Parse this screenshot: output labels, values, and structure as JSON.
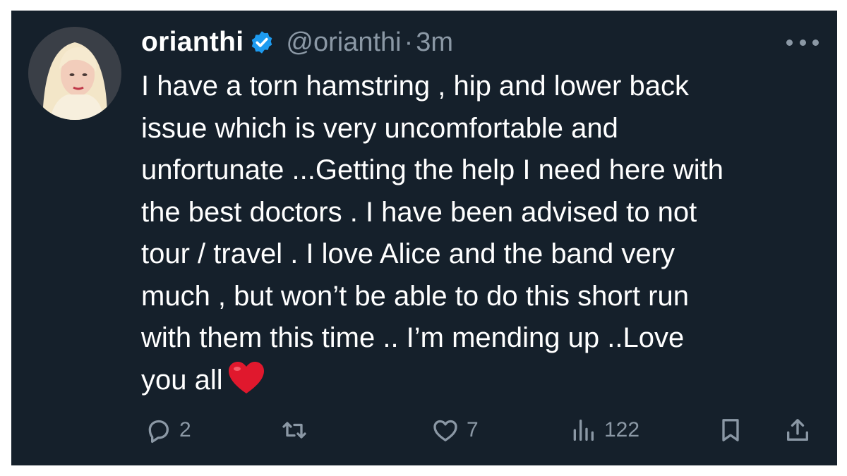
{
  "tweet": {
    "author": {
      "name": "orianthi",
      "handle": "@orianthi",
      "verified": true
    },
    "separator": "·",
    "time": "3m",
    "text_lines": [
      "I have a torn hamstring , hip and lower back",
      "issue which is very uncomfortable and",
      "unfortunate ...Getting the help I need here with",
      "the best doctors . I have been advised to not",
      "tour / travel . I love Alice and the band very",
      "much , but won’t be able to do this short run",
      "with them this time .. I’m mending up  ..Love",
      "you all"
    ],
    "emoji": "red-heart-emoji",
    "stats": {
      "replies": "2",
      "likes": "7",
      "views": "122"
    }
  },
  "icons": {
    "reply": "reply-icon",
    "retweet": "retweet-icon",
    "like": "heart-icon",
    "views": "views-icon",
    "bookmark": "bookmark-icon",
    "share": "share-icon",
    "more": "more-icon",
    "verified": "verified-badge-icon"
  },
  "colors": {
    "background": "#15202b",
    "text": "#ffffff",
    "muted": "#8b98a5",
    "verified": "#1d9bf0",
    "heart": "#e0182d"
  }
}
